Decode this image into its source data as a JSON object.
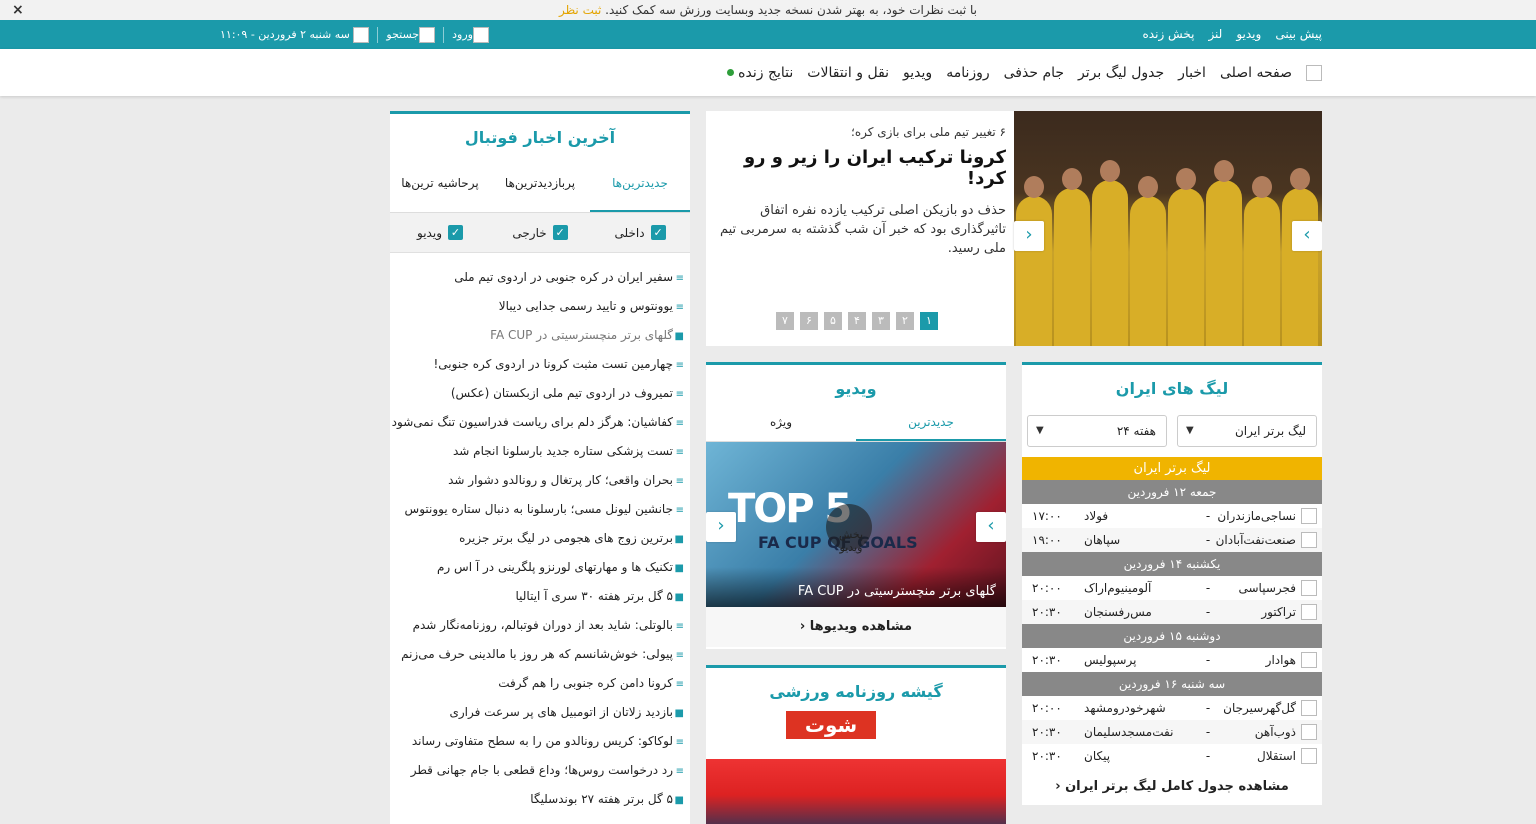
{
  "notice": {
    "text": "با ثبت نظرات خود، به بهتر شدن نسخه جدید وبسایت ورزش سه کمک کنید.",
    "link": "ثبت نظر",
    "close": "×"
  },
  "topbar": {
    "links": [
      "پیش بینی",
      "ویدیو",
      "لنز",
      "پخش زنده"
    ],
    "date": "سه شنبه ۲ فروردین - ۱۱:۰۹",
    "search": "جستجو",
    "login": "ورود"
  },
  "nav": {
    "items": [
      "صفحه اصلی",
      "اخبار",
      "جدول لیگ برتر",
      "جام حذفی",
      "روزنامه",
      "ویدیو",
      "نقل و انتقالات",
      "نتایج زنده"
    ]
  },
  "news": {
    "title": "آخرین اخبار فوتبال",
    "tabs": [
      "جدیدترین‌ها",
      "پربازدیدترین‌ها",
      "پرحاشیه ترین‌ها"
    ],
    "filters": [
      "داخلی",
      "خارجی",
      "ویدیو"
    ],
    "items": [
      "سفیر ایران در کره جنوبی در اردوی تیم ملی",
      "یوونتوس و تایید رسمی جدایی دیبالا",
      "گلهای برتر منچسترسیتی در FA CUP",
      "چهارمین تست مثبت کرونا در اردوی کره جنوبی!",
      "تمیروف در اردوی تیم ملی ازبکستان (عکس)",
      "کفاشیان: هرگز دلم برای ریاست فدراسیون تنگ نمی‌شود",
      "تست پزشکی ستاره جدید بارسلونا انجام شد",
      "بحران واقعی؛ کار پرتغال و رونالدو دشوار شد",
      "جانشین لیونل مسی؛ بارسلونا به دنبال ستاره یوونتوس",
      "برترین زوج های هجومی در لیگ برتر جزیره",
      "تکنیک ها و مهارتهای لورنزو پلگرینی در آ اس رم",
      "۵ گل برتر هفته ۳۰ سری آ ایتالیا",
      "بالوتلی: شاید بعد از دوران فوتبالم، روزنامه‌نگار شدم",
      "پیولی: خوش‌شانسم که هر روز با مالدینی حرف می‌زنم",
      "کرونا دامن کره جنوبی را هم گرفت",
      "بازدید زلاتان از اتومبیل های پر سرعت فراری",
      "لوکاکو: کریس رونالدو من را به سطح متفاوتی رساند",
      "رد درخواست روس‌ها؛ وداع قطعی با جام جهانی قطر",
      "۵ گل برتر هفته ۲۷ بوندسلیگا"
    ],
    "item_types": [
      "text",
      "text",
      "video",
      "text",
      "text",
      "text",
      "text",
      "text",
      "text",
      "video",
      "video",
      "video",
      "text",
      "text",
      "text",
      "video",
      "text",
      "text",
      "video"
    ]
  },
  "slider": {
    "subtitle": "۶ تغییر تیم ملی برای بازی کره؛",
    "title": "کرونا ترکیب ایران را زیر و رو کرد!",
    "lead": "حذف دو بازیکن اصلی ترکیب یازده نفره اتفاق تاثیرگذاری بود که خبر آن شب گذشته به سرمربی تیم ملی رسید.",
    "pages": [
      "۱",
      "۲",
      "۳",
      "۴",
      "۵",
      "۶",
      "۷"
    ],
    "active_page": 0
  },
  "video": {
    "title": "ویدیو",
    "tabs": [
      "جدیدترین",
      "ویژه"
    ],
    "thumb_title": "TOP 5",
    "thumb_sub": "FA CUP QF GOALS",
    "play_label": "پخش ویدیو",
    "caption": "گلهای برتر منچسترسیتی در FA CUP",
    "more": "مشاهده ویدیوها"
  },
  "paper": {
    "title": "گیشه روزنامه ورزشی",
    "masthead": "شوت"
  },
  "league": {
    "title": "لیگ های ایران",
    "league_select": "لیگ برتر ایران",
    "week_select": "هفته ۲۴",
    "league_name": "لیگ برتر ایران",
    "days": [
      {
        "label": "جمعه ۱۲ فروردین",
        "matches": [
          {
            "home": "نساجی‌مازندران",
            "away": "فولاد",
            "time": "۱۷:۰۰"
          },
          {
            "home": "صنعت‌نفت‌آبادان",
            "away": "سپاهان",
            "time": "۱۹:۰۰"
          }
        ]
      },
      {
        "label": "یکشنبه ۱۴ فروردین",
        "matches": [
          {
            "home": "فجرسپاسی",
            "away": "آلومینیوم‌اراک",
            "time": "۲۰:۰۰"
          },
          {
            "home": "تراکتور",
            "away": "مس‌رفسنجان",
            "time": "۲۰:۳۰"
          }
        ]
      },
      {
        "label": "دوشنبه ۱۵ فروردین",
        "matches": [
          {
            "home": "هوادار",
            "away": "پرسپولیس",
            "time": "۲۰:۳۰"
          }
        ]
      },
      {
        "label": "سه شنبه ۱۶ فروردین",
        "matches": [
          {
            "home": "گل‌گهرسیرجان",
            "away": "شهرخودرومشهد",
            "time": "۲۰:۰۰"
          },
          {
            "home": "ذوب‌آهن",
            "away": "نفت‌مسجدسلیمان",
            "time": "۲۰:۳۰"
          },
          {
            "home": "استقلال",
            "away": "پیکان",
            "time": "۲۰:۳۰"
          }
        ]
      }
    ],
    "more": "مشاهده جدول کامل لیگ برتر ایران"
  },
  "colors": {
    "accent": "#1b9aaa",
    "league_bar": "#f0b400",
    "day_bar": "#888888"
  }
}
